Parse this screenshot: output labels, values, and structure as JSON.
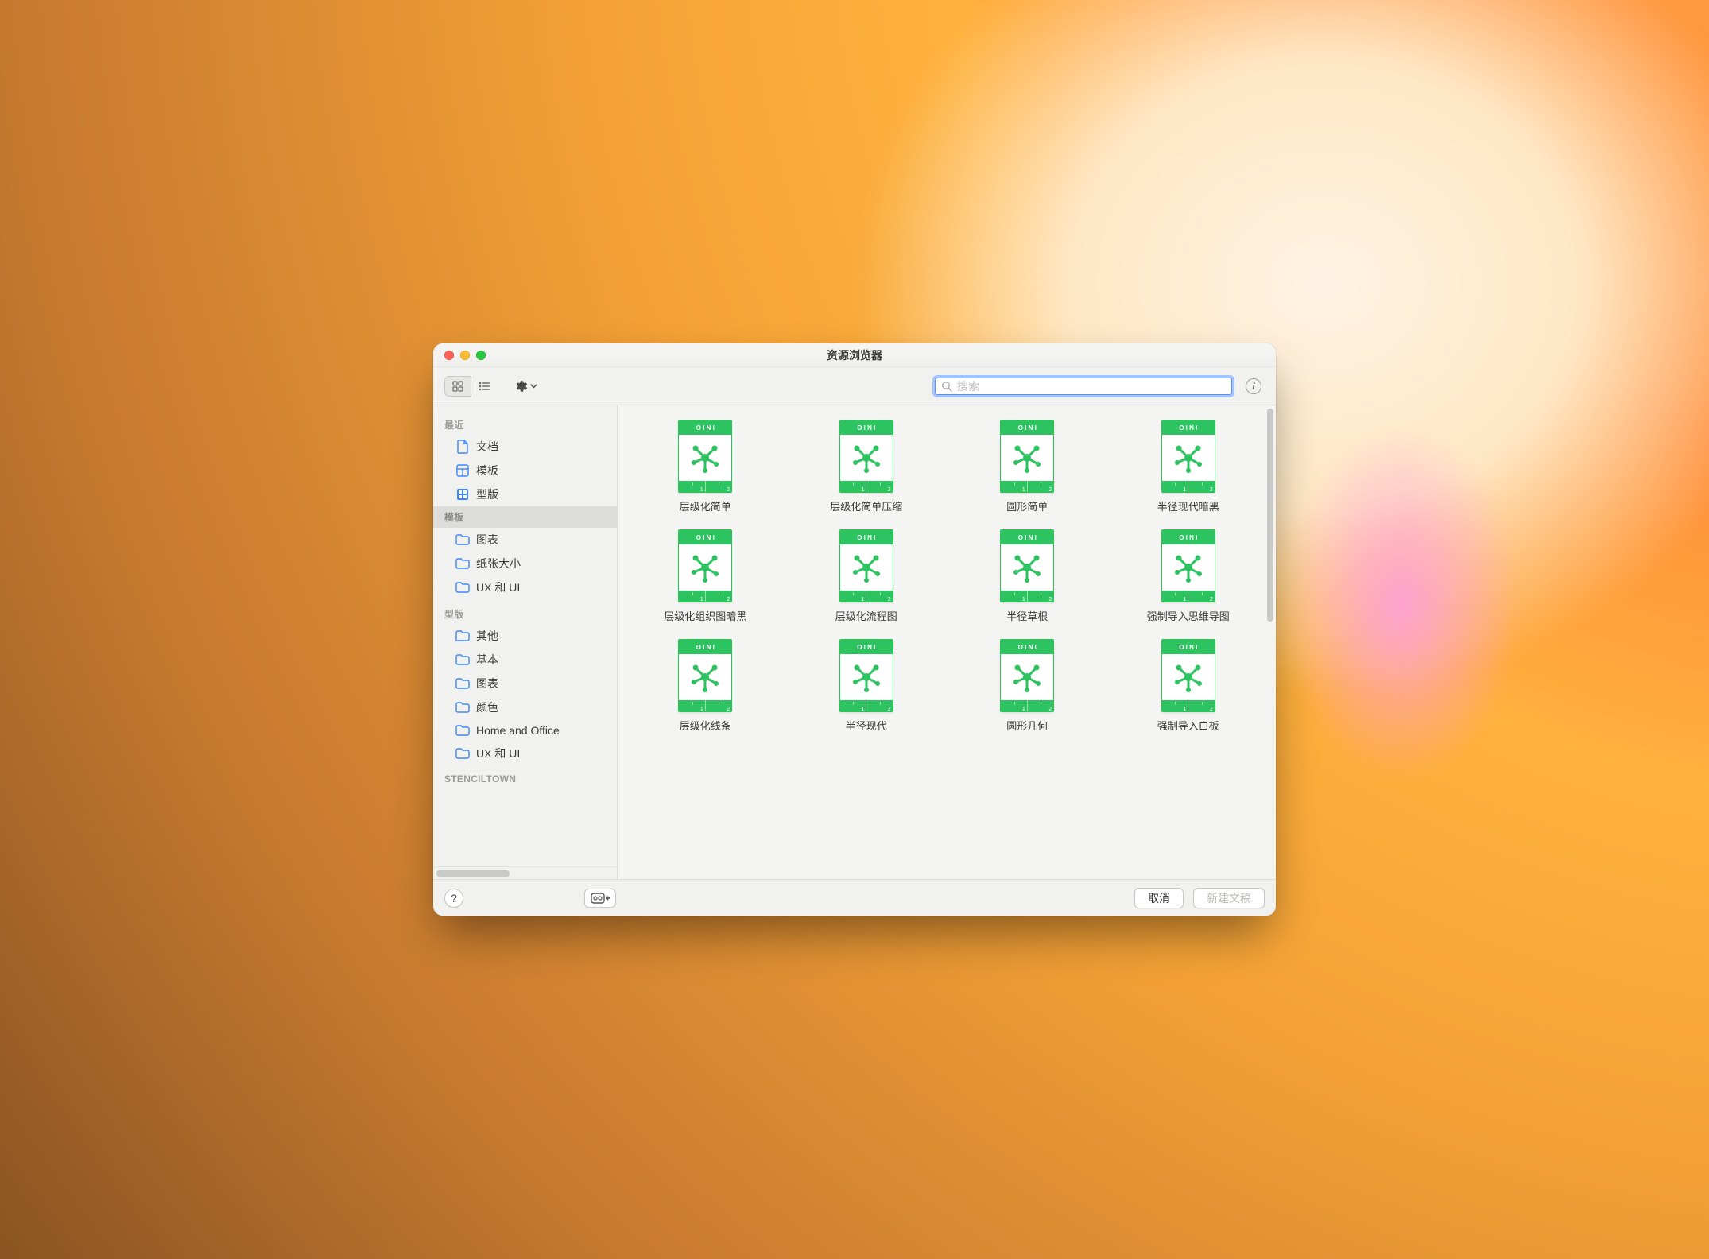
{
  "window_title": "资源浏览器",
  "search": {
    "placeholder": "搜索"
  },
  "sidebar": {
    "sections": [
      {
        "label": "最近",
        "items": [
          {
            "icon": "doc",
            "label": "文档"
          },
          {
            "icon": "grid",
            "label": "模板"
          },
          {
            "icon": "stencil",
            "label": "型版"
          }
        ]
      },
      {
        "label": "模板",
        "selected": true,
        "items": [
          {
            "icon": "folder",
            "label": "图表"
          },
          {
            "icon": "folder",
            "label": "纸张大小"
          },
          {
            "icon": "folder",
            "label": "UX 和 UI"
          }
        ]
      },
      {
        "label": "型版",
        "items": [
          {
            "icon": "folder",
            "label": "其他"
          },
          {
            "icon": "folder",
            "label": "基本"
          },
          {
            "icon": "folder",
            "label": "图表"
          },
          {
            "icon": "folder",
            "label": "颜色"
          },
          {
            "icon": "folder",
            "label": "Home and Office"
          },
          {
            "icon": "folder",
            "label": "UX 和 UI"
          }
        ]
      },
      {
        "label": "STENCILTOWN",
        "items": []
      }
    ]
  },
  "templates": [
    {
      "label": "层级化简单"
    },
    {
      "label": "层级化简单压缩"
    },
    {
      "label": "圆形简单"
    },
    {
      "label": "半径现代暗黑"
    },
    {
      "label": "层级化组织图暗黑"
    },
    {
      "label": "层级化流程图"
    },
    {
      "label": "半径草根"
    },
    {
      "label": "强制导入思维导图"
    },
    {
      "label": "层级化线条"
    },
    {
      "label": "半径现代"
    },
    {
      "label": "圆形几何"
    },
    {
      "label": "强制导入白板"
    }
  ],
  "footer": {
    "help": "?",
    "cancel": "取消",
    "new_doc": "新建文稿"
  }
}
